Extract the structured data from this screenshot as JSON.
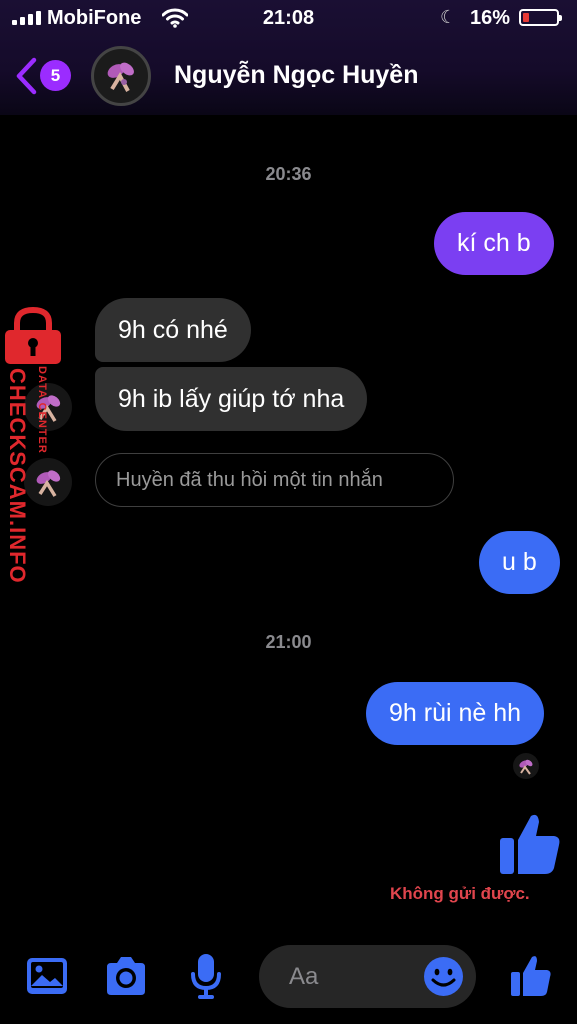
{
  "status_bar": {
    "carrier": "MobiFone",
    "time": "21:08",
    "battery_percent": "16%",
    "battery_level": 0.16,
    "icons": [
      "signal-icon",
      "wifi-icon",
      "moon-icon",
      "battery-icon"
    ]
  },
  "header": {
    "back_badge": "5",
    "contact_name": "Nguyễn Ngọc Huyền"
  },
  "messages": {
    "timestamp_1": "20:36",
    "out_1": "kí ch b",
    "in_1": "9h có nhé",
    "in_2": "9h ib lấy giúp tớ nha",
    "recalled": "Huyền đã thu hồi một tin nhắn",
    "out_2": "u b",
    "timestamp_2": "21:00",
    "out_3": "9h rùi nè hh",
    "send_failed": "Không gửi được."
  },
  "watermark": {
    "main": "CHECKSCAM.INFO",
    "sub": "DATA CENTER"
  },
  "composer": {
    "placeholder": "Aa"
  },
  "colors": {
    "accent_blue": "#3b6cf5",
    "accent_purple": "#7b3ff2",
    "badge": "#9b2cff",
    "error": "#e0454d",
    "incoming_bubble": "#303030",
    "watermark_red": "#e0282d"
  }
}
